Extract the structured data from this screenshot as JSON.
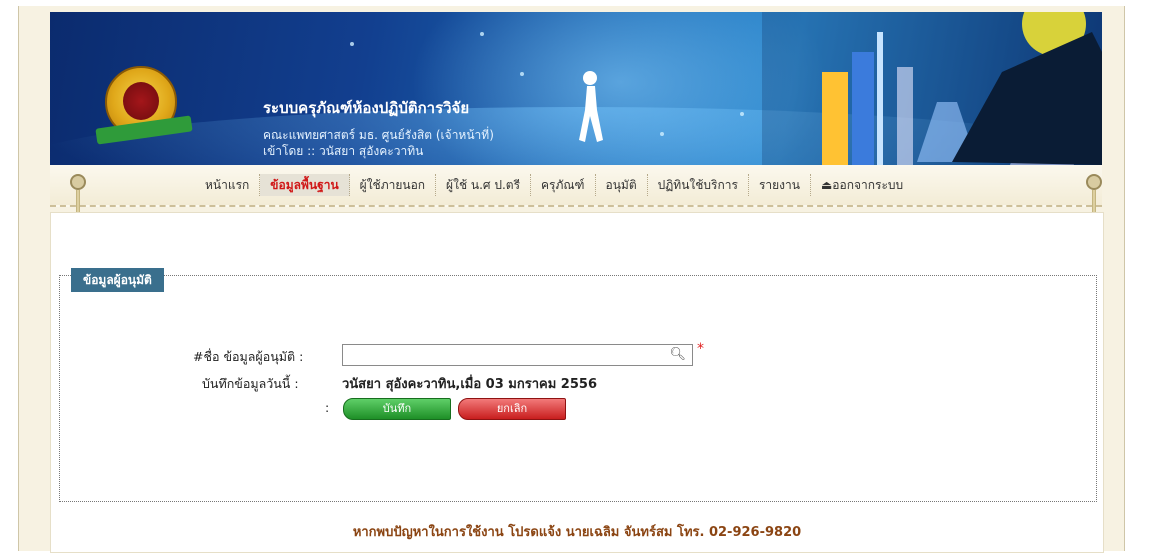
{
  "header": {
    "system_title": "ระบบครุภัณฑ์ห้องปฏิบัติการวิจัย",
    "faculty": "คณะแพทยศาสตร์ มธ. ศูนย์รังสิต (เจ้าหน้าที่)",
    "login_by": "เข้าโดย :: วนัสยา สุอังคะวาทิน"
  },
  "menu": {
    "items": [
      {
        "label": "หน้าแรก"
      },
      {
        "label": "ข้อมูลพื้นฐาน"
      },
      {
        "label": "ผู้ใช้ภายนอก"
      },
      {
        "label": "ผู้ใช้ น.ศ ป.ตรี"
      },
      {
        "label": "ครุภัณฑ์"
      },
      {
        "label": "อนุมัติ"
      },
      {
        "label": "ปฏิทินใช้บริการ"
      },
      {
        "label": "รายงาน"
      },
      {
        "label": "ออกจากระบบ"
      }
    ],
    "active_index": 1
  },
  "form": {
    "section_title": "ข้อมูลผู้อนุมัติ",
    "approver_label": "#ชื่อ ข้อมูลผู้อนุมัติ :",
    "approver_value": "",
    "required_mark": "*",
    "record_label": "บันทึกข้อมูลวันนี้ :",
    "record_value": "วนัสยา สุอังคะวาทิน,เมื่อ 03 มกราคม 2556",
    "buttons_label": ":",
    "save_label": "บันทึก",
    "cancel_label": "ยกเลิก"
  },
  "footer": {
    "text": "หากพบปัญหาในการใช้งาน โปรดแจ้ง นายเฉลิม จันทร์สม โทร. 02-926-9820"
  },
  "colors": {
    "active_menu": "#d01818",
    "legend_bg": "#3a6f8d",
    "save_button": "#1e8f27",
    "cancel_button": "#c81e1e",
    "footer_text": "#8b4513"
  }
}
